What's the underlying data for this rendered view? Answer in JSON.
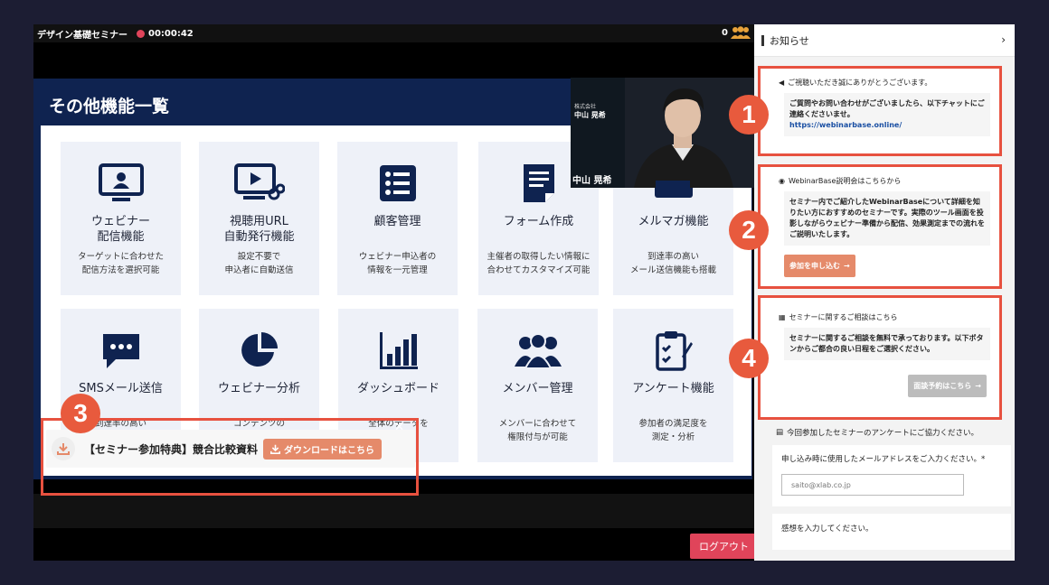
{
  "topbar": {
    "title": "デザイン基礎セミナー",
    "timer": "00:00:42",
    "viewer_count": "0"
  },
  "slide": {
    "title": "その他機能一覧",
    "cards": [
      {
        "title": "ウェビナー\n配信機能",
        "desc": "ターゲットに合わせた\n配信方法を選択可能",
        "icon": "monitor-user-icon"
      },
      {
        "title": "視聴用URL\n自動発行機能",
        "desc": "設定不要で\n申込者に自動送信",
        "icon": "video-link-icon"
      },
      {
        "title": "顧客管理",
        "desc": "ウェビナー申込者の\n情報を一元管理",
        "icon": "customer-list-icon"
      },
      {
        "title": "フォーム作成",
        "desc": "主催者の取得したい情報に\n合わせてカスタマイズ可能",
        "icon": "form-document-icon"
      },
      {
        "title": "メルマガ機能",
        "desc": "到達率の高い\nメール送信機能も搭載",
        "icon": "mail-icon"
      },
      {
        "title": "SMSメール送信",
        "desc": "到達率の高い\n",
        "icon": "chat-bubble-icon"
      },
      {
        "title": "ウェビナー分析",
        "desc": "コンテンツの\n",
        "icon": "pie-chart-icon"
      },
      {
        "title": "ダッシュボード",
        "desc": "全体のデータを\n",
        "icon": "bar-chart-icon"
      },
      {
        "title": "メンバー管理",
        "desc": "メンバーに合わせて\n権限付与が可能",
        "icon": "members-icon"
      },
      {
        "title": "アンケート機能",
        "desc": "参加者の満足度を\n測定・分析",
        "icon": "clipboard-check-icon"
      }
    ]
  },
  "presenter": {
    "name": "中山 晃希",
    "company_line1": "株式会社",
    "name_small": "中山 晃希"
  },
  "banner": {
    "text": "【セミナー参加特典】競合比較資料",
    "button": "ダウンロードはこちら"
  },
  "logout": "ログアウト",
  "sidebar": {
    "title": "お知らせ",
    "notices": [
      {
        "heading": "ご視聴いただき誠にありがとうございます。",
        "body": "ご質問やお問い合わせがございましたら、以下チャットにご連絡くださいませ。",
        "link": "https://webinarbase.online/"
      },
      {
        "heading": "WebinarBase説明会はこちらから",
        "body": "セミナー内でご紹介したWebinarBaseについて詳細を知りたい方におすすめのセミナーです。実際のツール画面を投影しながらウェビナー準備から配信、効果測定までの流れをご説明いたします。",
        "button": "参加を申し込む"
      },
      {
        "heading": "セミナーに関するご相談はこちら",
        "body": "セミナーに関するご相談を無料で承っております。以下ボタンからご都合の良い日程をご選択ください。",
        "button": "面談予約はこちら"
      }
    ],
    "survey": {
      "heading": "今回参加したセミナーのアンケートにご協力ください。",
      "q1": "申し込み時に使用したメールアドレスをご入力ください。*",
      "q1_value": "saito@xlab.co.jp",
      "q2": "感想を入力してください。"
    }
  },
  "badges": [
    "1",
    "2",
    "3",
    "4"
  ],
  "colors": {
    "accent": "#e7513f",
    "slide_bg": "#0f2350",
    "logout": "#e0445a"
  }
}
